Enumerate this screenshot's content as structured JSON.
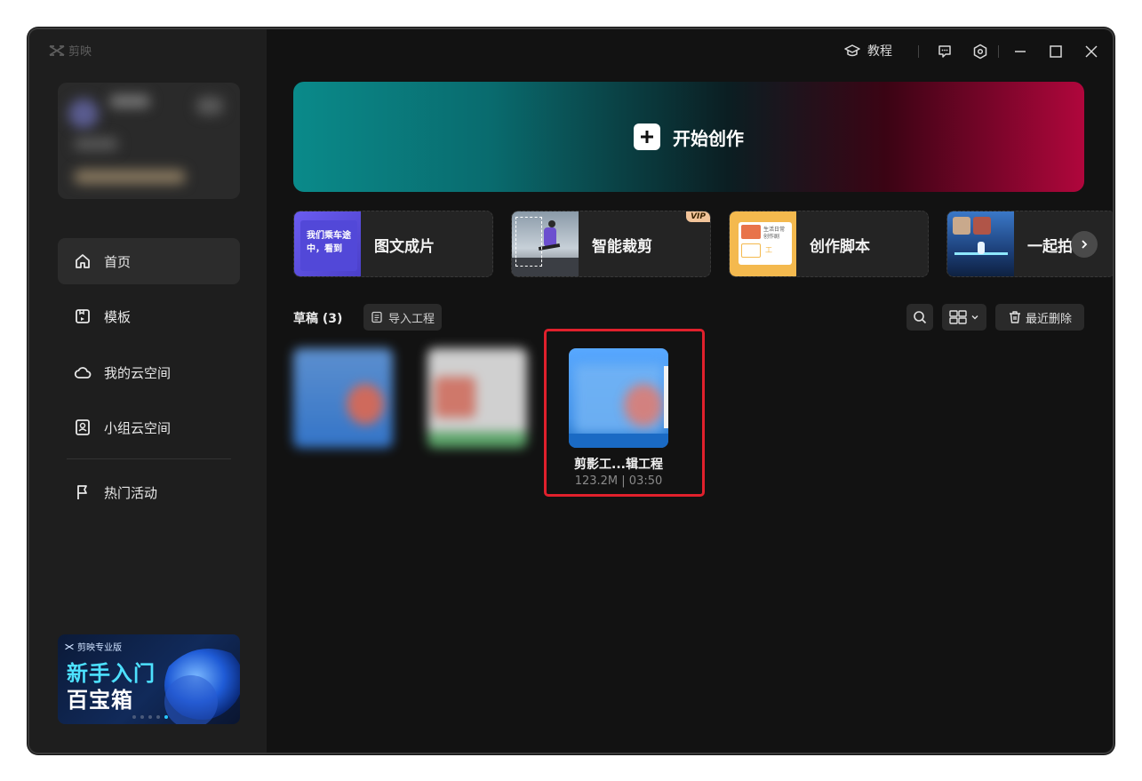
{
  "app": {
    "name": "剪映"
  },
  "titlebar": {
    "tutorial_label": "教程"
  },
  "sidebar": {
    "items": [
      {
        "label": "首页",
        "icon": "home-icon",
        "active": true
      },
      {
        "label": "模板",
        "icon": "template-icon",
        "active": false
      },
      {
        "label": "我的云空间",
        "icon": "cloud-icon",
        "active": false
      },
      {
        "label": "小组云空间",
        "icon": "group-cloud-icon",
        "active": false
      },
      {
        "label": "热门活动",
        "icon": "flag-icon",
        "active": false
      }
    ],
    "promo": {
      "brand": "剪映专业版",
      "line1": "新手入门",
      "line2": "百宝箱"
    }
  },
  "hero": {
    "label": "开始创作"
  },
  "tools": [
    {
      "label": "图文成片",
      "thumb_text": "我们乘车途中，看到"
    },
    {
      "label": "智能裁剪",
      "badge": "VIP"
    },
    {
      "label": "创作脚本",
      "thumb_lines": [
        "生活日常",
        "创作剧",
        "工"
      ]
    },
    {
      "label": "一起拍"
    }
  ],
  "drafts": {
    "title": "草稿 (3)",
    "import_label": "导入工程",
    "recent_delete_label": "最近删除",
    "items": [
      {
        "name": "",
        "meta": "",
        "blurred": true
      },
      {
        "name": "",
        "meta": "",
        "blurred": true
      },
      {
        "name": "剪影工...辑工程",
        "meta": "123.2M | 03:50",
        "blurred": false
      }
    ]
  },
  "colors": {
    "accent_teal": "#0a8a8a",
    "accent_red": "#b0063c",
    "highlight_red": "#e0202c"
  }
}
